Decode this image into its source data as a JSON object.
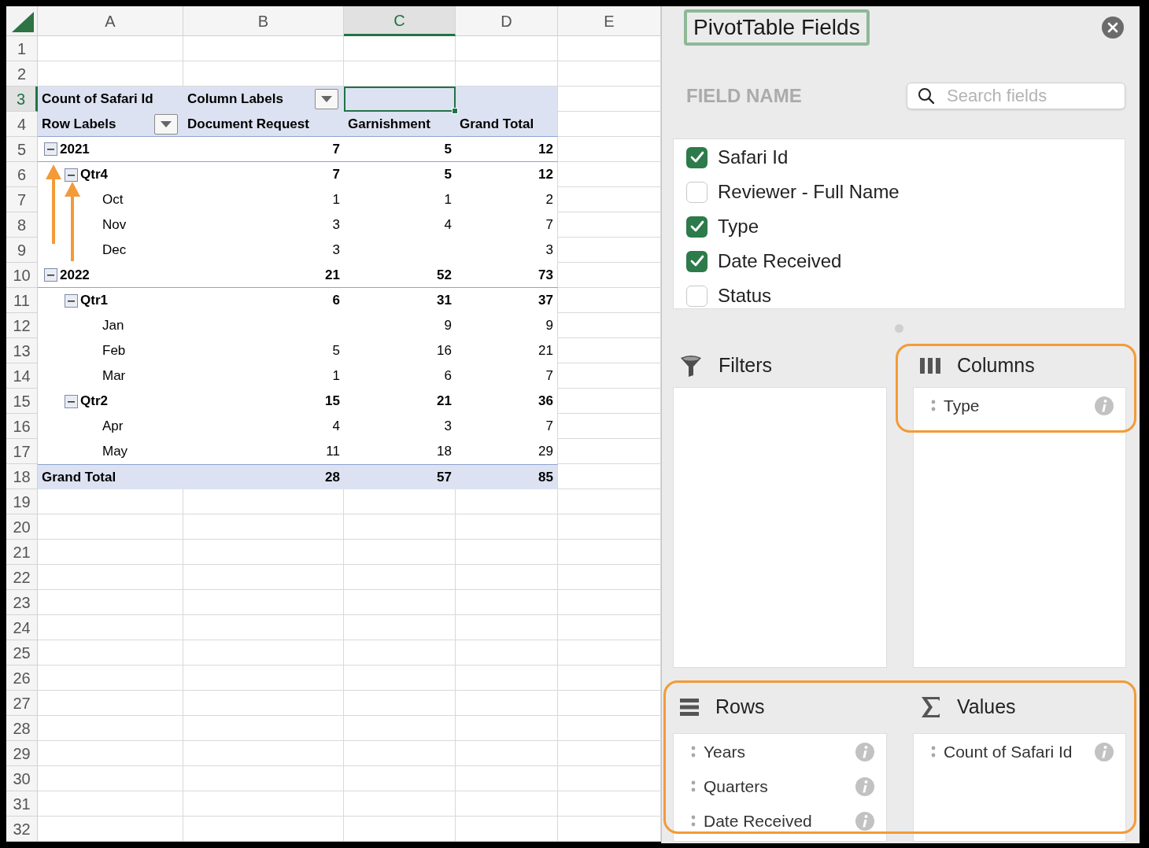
{
  "sheet": {
    "columns": [
      {
        "label": "A",
        "selected": false
      },
      {
        "label": "B",
        "selected": false
      },
      {
        "label": "C",
        "selected": true
      },
      {
        "label": "D",
        "selected": false
      },
      {
        "label": "E",
        "selected": false
      }
    ],
    "rows": [
      {
        "label": "1",
        "selected": false
      },
      {
        "label": "2",
        "selected": false
      },
      {
        "label": "3",
        "selected": true
      },
      {
        "label": "4",
        "selected": false
      },
      {
        "label": "5",
        "selected": false
      },
      {
        "label": "6",
        "selected": false
      },
      {
        "label": "7",
        "selected": false
      },
      {
        "label": "8",
        "selected": false
      },
      {
        "label": "9",
        "selected": false
      },
      {
        "label": "10",
        "selected": false
      },
      {
        "label": "11",
        "selected": false
      },
      {
        "label": "12",
        "selected": false
      },
      {
        "label": "13",
        "selected": false
      },
      {
        "label": "14",
        "selected": false
      },
      {
        "label": "15",
        "selected": false
      },
      {
        "label": "16",
        "selected": false
      },
      {
        "label": "17",
        "selected": false
      },
      {
        "label": "18",
        "selected": false
      },
      {
        "label": "19",
        "selected": false
      },
      {
        "label": "20",
        "selected": false
      },
      {
        "label": "21",
        "selected": false
      },
      {
        "label": "22",
        "selected": false
      },
      {
        "label": "23",
        "selected": false
      },
      {
        "label": "24",
        "selected": false
      },
      {
        "label": "25",
        "selected": false
      },
      {
        "label": "26",
        "selected": false
      },
      {
        "label": "27",
        "selected": false
      },
      {
        "label": "28",
        "selected": false
      },
      {
        "label": "29",
        "selected": false
      },
      {
        "label": "30",
        "selected": false
      },
      {
        "label": "31",
        "selected": false
      },
      {
        "label": "32",
        "selected": false
      }
    ]
  },
  "pivot": {
    "value_label": "Count of Safari Id",
    "column_labels": "Column Labels",
    "row_labels": "Row Labels",
    "column_headers": [
      "Document Request",
      "Garnishment",
      "Grand Total"
    ],
    "rows": [
      {
        "kind": "year",
        "label": "2021",
        "expanded": true,
        "document_request": "7",
        "garnishment": "5",
        "grand_total": "12"
      },
      {
        "kind": "quarter",
        "label": "Qtr4",
        "expanded": true,
        "document_request": "7",
        "garnishment": "5",
        "grand_total": "12"
      },
      {
        "kind": "month",
        "label": "Oct",
        "document_request": "1",
        "garnishment": "1",
        "grand_total": "2"
      },
      {
        "kind": "month",
        "label": "Nov",
        "document_request": "3",
        "garnishment": "4",
        "grand_total": "7"
      },
      {
        "kind": "month",
        "label": "Dec",
        "document_request": "3",
        "grand_total": "3"
      },
      {
        "kind": "year",
        "label": "2022",
        "expanded": true,
        "document_request": "21",
        "garnishment": "52",
        "grand_total": "73"
      },
      {
        "kind": "quarter",
        "label": "Qtr1",
        "expanded": true,
        "document_request": "6",
        "garnishment": "31",
        "grand_total": "37"
      },
      {
        "kind": "month",
        "label": "Jan",
        "garnishment": "9",
        "grand_total": "9"
      },
      {
        "kind": "month",
        "label": "Feb",
        "document_request": "5",
        "garnishment": "16",
        "grand_total": "21"
      },
      {
        "kind": "month",
        "label": "Mar",
        "document_request": "1",
        "garnishment": "6",
        "grand_total": "7"
      },
      {
        "kind": "quarter",
        "label": "Qtr2",
        "expanded": true,
        "document_request": "15",
        "garnishment": "21",
        "grand_total": "36"
      },
      {
        "kind": "month",
        "label": "Apr",
        "document_request": "4",
        "garnishment": "3",
        "grand_total": "7"
      },
      {
        "kind": "month",
        "label": "May",
        "document_request": "11",
        "garnishment": "18",
        "grand_total": "29"
      },
      {
        "kind": "total",
        "label": "Grand Total",
        "document_request": "28",
        "garnishment": "57",
        "grand_total": "85"
      }
    ]
  },
  "panel": {
    "title": "PivotTable Fields",
    "section_label": "FIELD NAME",
    "search": {
      "placeholder": "Search fields"
    },
    "fields": [
      {
        "label": "Safari Id",
        "checked": true
      },
      {
        "label": "Reviewer - Full Name",
        "checked": false
      },
      {
        "label": "Type",
        "checked": true
      },
      {
        "label": "Date Received",
        "checked": true
      },
      {
        "label": "Status",
        "checked": false
      }
    ],
    "areas": [
      {
        "kind": "filters",
        "label": "Filters"
      },
      {
        "kind": "columns",
        "label": "Columns",
        "items": [
          "Type"
        ]
      },
      {
        "kind": "rows",
        "label": "Rows",
        "items": [
          "Years",
          "Quarters",
          "Date Received"
        ]
      },
      {
        "kind": "values",
        "label": "Values",
        "items": [
          "Count of Safari Id"
        ]
      }
    ]
  }
}
